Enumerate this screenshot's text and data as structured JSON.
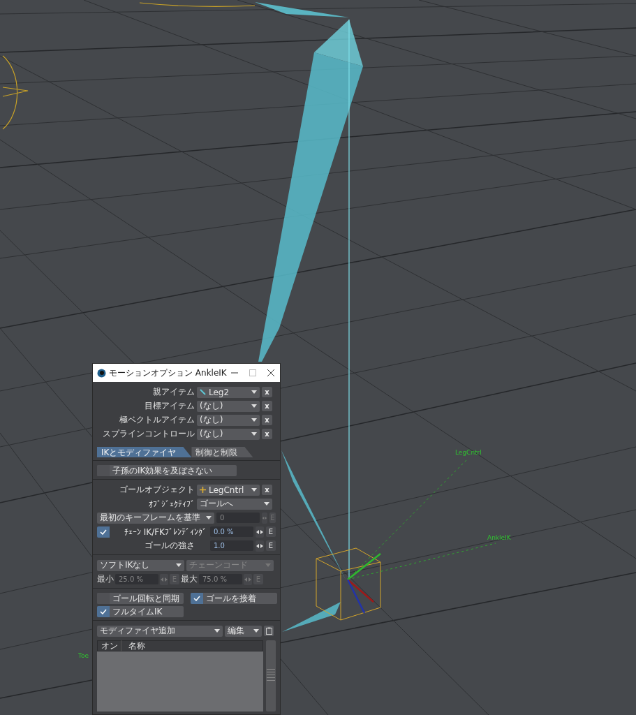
{
  "viewport": {
    "labels": [
      {
        "text": "LegCntrl"
      },
      {
        "text": "AnkleIK"
      },
      {
        "text": "Toe"
      }
    ]
  },
  "window": {
    "title": "モーションオプション AnkleIK"
  },
  "items": [
    {
      "label": "親アイテム",
      "value": "Leg2",
      "kind": "bone",
      "clear": "x"
    },
    {
      "label": "目標アイテム",
      "value": "(なし)",
      "kind": "empty",
      "clear": "x"
    },
    {
      "label": "極ベクトルアイテム",
      "value": "(なし)",
      "kind": "empty",
      "clear": "x"
    },
    {
      "label": "スプラインコントロール",
      "value": "(なし)",
      "kind": "empty",
      "clear": "x"
    }
  ],
  "tabs": [
    {
      "label": "IKとモディファイヤ",
      "selected": true
    },
    {
      "label": "制御と制限",
      "selected": false
    }
  ],
  "descendants_toggle": {
    "label": "子孫のIK効果を及ぼさない",
    "checked": false
  },
  "goal_object": {
    "label": "ゴールオブジェクト",
    "value": "LegCntrl",
    "kind": "null",
    "clear": "x"
  },
  "objective": {
    "label": "ｵﾌﾞｼﾞｪｸﾃｨﾌﾞ",
    "value": "ゴールへ"
  },
  "keyframe": {
    "mode": "最初のキーフレームを基準",
    "value": "0",
    "disabled": true,
    "env": "E"
  },
  "blending": {
    "label": "ﾁｪｰﾝ IK/FKﾌﾞﾚﾝﾃﾞｨﾝｸﾞ",
    "checked": true,
    "value": "0.0 %",
    "disabled": false,
    "env": "E"
  },
  "goal_strength": {
    "label": "ゴールの強さ",
    "value": "1.0",
    "disabled": false,
    "env": "E"
  },
  "soft_ik": {
    "mode": "ソフトIKなし",
    "chain": "チェーンコード",
    "chain_disabled": true,
    "min": {
      "label": "最小",
      "value": "25.0 %",
      "disabled": true,
      "env": "E"
    },
    "max": {
      "label": "最大",
      "value": "75.0 %",
      "disabled": true,
      "env": "E"
    }
  },
  "options": [
    {
      "label": "ゴール回転と同期",
      "checked": false
    },
    {
      "label": "ゴールを接着",
      "checked": true
    },
    {
      "label": "フルタイムIK",
      "checked": true
    }
  ],
  "modifiers": {
    "add": "モディファイヤ追加",
    "edit": "編集",
    "columns": [
      "オン",
      "名称"
    ]
  }
}
